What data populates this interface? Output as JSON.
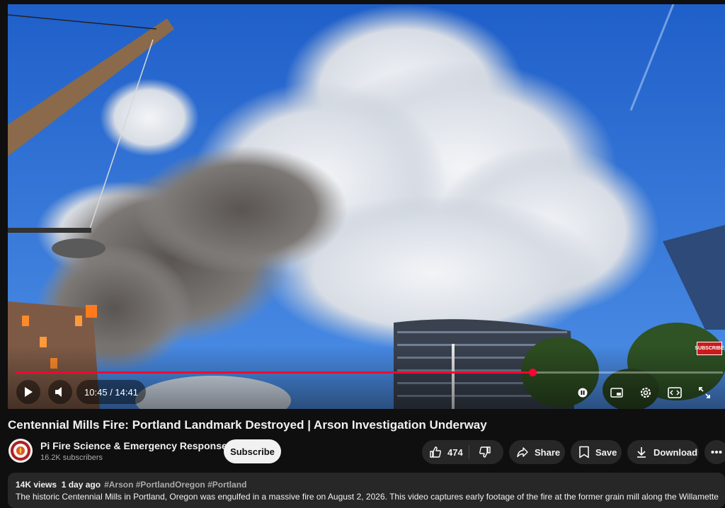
{
  "player": {
    "current_time": "10:45",
    "duration": "14:41",
    "time_display": "10:45 / 14:41",
    "progress_fraction": 0.731,
    "subscribe_watermark": "SUBSCRIBE",
    "accent_color": "#ff0033",
    "icons": [
      "play-icon",
      "volume-icon",
      "pause-pill-icon",
      "miniplayer-icon",
      "settings-icon",
      "theater-icon",
      "fullscreen-icon"
    ]
  },
  "video": {
    "title": "Centennial Mills Fire: Portland Landmark Destroyed | Arson Investigation Underway"
  },
  "channel": {
    "name": "Pi Fire Science & Emergency Response",
    "subscribers": "16.2K subscribers",
    "subscribe_label": "Subscribe"
  },
  "actions": {
    "like_count": "474",
    "share_label": "Share",
    "save_label": "Save",
    "download_label": "Download"
  },
  "description": {
    "views": "14K views",
    "age": "1 day ago",
    "hashtags": "#Arson #PortlandOregon #Portland",
    "text": "The historic Centennial Mills in Portland, Oregon was engulfed in a massive fire on August 2, 2026. This video captures early footage of the fire at the former grain mill along the Willamette"
  }
}
